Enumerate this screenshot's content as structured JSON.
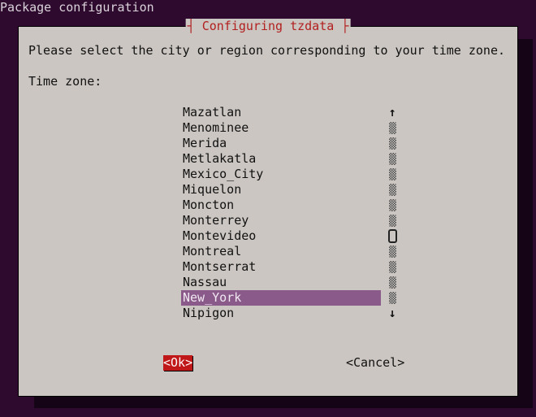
{
  "header": "Package configuration",
  "dialog": {
    "title": " Configuring tzdata ",
    "title_markers": "┤├",
    "prompt": "Please select the city or region corresponding to your time zone.",
    "field_label": "Time zone:"
  },
  "list": {
    "items": [
      "Mazatlan",
      "Menominee",
      "Merida",
      "Metlakatla",
      "Mexico_City",
      "Miquelon",
      "Moncton",
      "Monterrey",
      "Montevideo",
      "Montreal",
      "Montserrat",
      "Nassau",
      "New_York",
      "Nipigon"
    ],
    "selected_index": 12
  },
  "scroll": {
    "up_arrow": "↑",
    "down_arrow": "↓",
    "thumb_index": 8,
    "rows": 14
  },
  "buttons": {
    "ok": "<Ok>",
    "cancel": "<Cancel>"
  },
  "colors": {
    "bg": "#2f0a2f",
    "panel": "#cbc6c1",
    "accent_red": "#b22020",
    "button_red": "#c01818",
    "select_bg": "#8a5a8a"
  }
}
